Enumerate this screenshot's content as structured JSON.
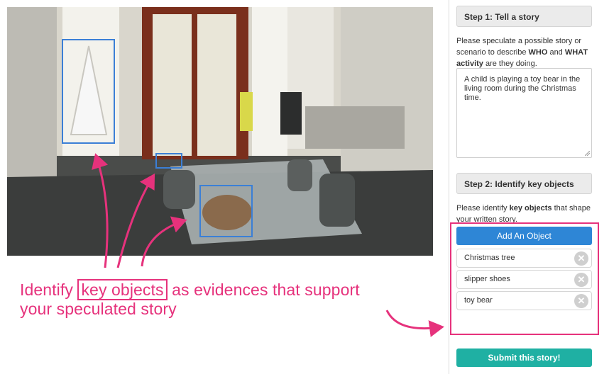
{
  "step1": {
    "header": "Step 1: Tell a story",
    "instruction_pre": "Please speculate a possible story or scenario to describe ",
    "instruction_who": "WHO",
    "instruction_and": " and ",
    "instruction_what": "WHAT activity",
    "instruction_post": " are they doing.",
    "story_text": "A child is playing a toy bear in the living room during the Christmas time."
  },
  "step2": {
    "header": "Step 2: Identify key objects",
    "instruction_pre": "Please identify ",
    "instruction_bold": "key objects",
    "instruction_post": " that shape your written story.",
    "add_button": "Add An Object",
    "objects": [
      {
        "label": "Christmas tree"
      },
      {
        "label": "slipper shoes"
      },
      {
        "label": "toy bear"
      }
    ],
    "remove_icon": "close-circle-icon"
  },
  "submit_button": "Submit this story!",
  "annotation": {
    "prefix": "Identify ",
    "highlight": "key objects",
    "suffix": " as evidences that support",
    "line2": "your speculated story"
  },
  "colors": {
    "accent_pink": "#e6327c",
    "box_blue": "#3b7fd6",
    "add_button": "#2e86d6",
    "submit_button": "#1fb0a3"
  }
}
